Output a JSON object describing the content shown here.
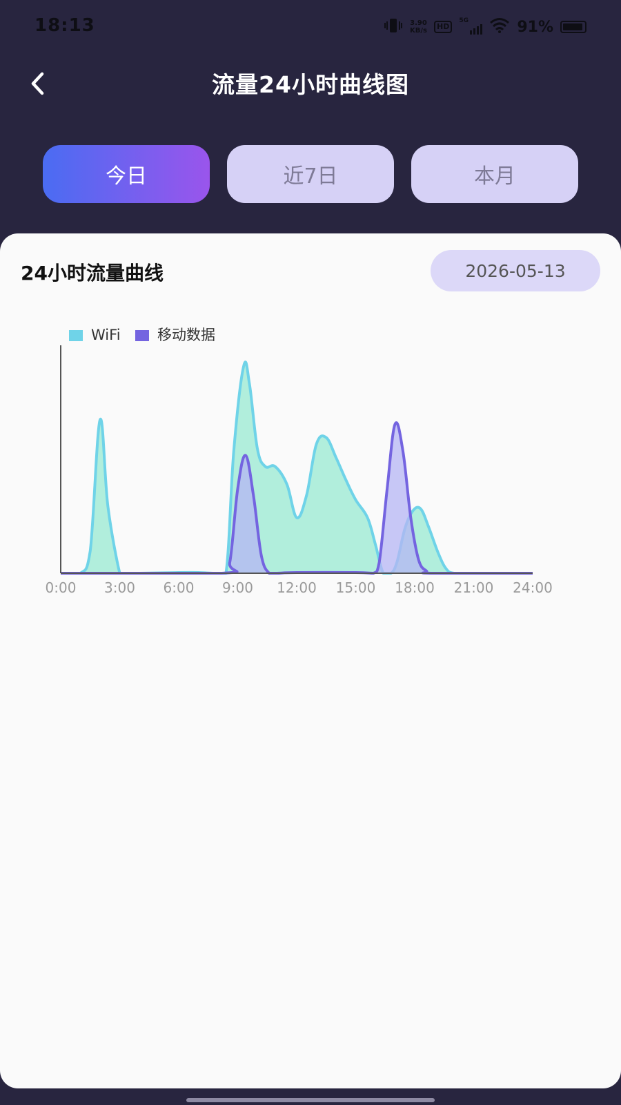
{
  "status_bar": {
    "time": "18:13",
    "net_speed_value": "3.90",
    "net_speed_unit": "KB/s",
    "hd_label": "HD",
    "network_label": "5G",
    "battery_percent": "91%",
    "battery_level": 0.91
  },
  "header": {
    "back_icon": "chevron-left-icon",
    "title": "流量24小时曲线图"
  },
  "tabs": [
    {
      "label": "今日",
      "active": true
    },
    {
      "label": "近7日",
      "active": false
    },
    {
      "label": "本月",
      "active": false
    }
  ],
  "card": {
    "title": "24小时流量曲线",
    "date": "2026-05-13"
  },
  "colors": {
    "background": "#28253f",
    "wifi_fill": "#a8ecd8",
    "wifi_line": "#6fd3e8",
    "mobile_fill": "#b6b6f4",
    "mobile_line": "#7464e0",
    "axis": "#555555",
    "tick_label": "#9a9a9a"
  },
  "chart_data": {
    "type": "area",
    "title": "",
    "xlabel": "",
    "ylabel": "",
    "x_ticks": [
      "0:00",
      "3:00",
      "6:00",
      "9:00",
      "12:00",
      "15:00",
      "18:00",
      "21:00",
      "24:00"
    ],
    "xlim": [
      0,
      24
    ],
    "ylim": [
      0,
      1
    ],
    "y_axis_labels_shown": false,
    "grid": false,
    "legend_position": "top-left",
    "series": [
      {
        "name": "WiFi",
        "x": [
          0,
          1,
          1.5,
          2,
          2.4,
          3,
          3.2,
          4,
          6,
          7,
          7.8,
          8.4,
          8.8,
          9.3,
          9.6,
          10,
          10.4,
          10.9,
          11.5,
          12,
          12.5,
          13,
          13.5,
          14,
          14.5,
          15,
          15.6,
          16,
          16.4,
          16.8,
          17.1,
          17.5,
          17.9,
          18.3,
          18.7,
          19.2,
          19.6,
          20,
          21,
          24
        ],
        "values": [
          0,
          0,
          0.1,
          0.69,
          0.3,
          0,
          0,
          0,
          0.003,
          0.003,
          0,
          0,
          0.55,
          0.93,
          0.85,
          0.56,
          0.48,
          0.48,
          0.4,
          0.25,
          0.35,
          0.58,
          0.61,
          0.52,
          0.42,
          0.33,
          0.25,
          0.13,
          0,
          0,
          0.05,
          0.2,
          0.28,
          0.29,
          0.21,
          0.09,
          0.02,
          0,
          0,
          0
        ]
      },
      {
        "name": "移动数据",
        "x": [
          0,
          8.2,
          8.6,
          9,
          9.4,
          9.8,
          10.2,
          10.6,
          11,
          12,
          15,
          15.9,
          16.2,
          16.6,
          17,
          17.4,
          17.8,
          18.2,
          18.6,
          18.9,
          24
        ],
        "values": [
          0,
          0,
          0.05,
          0.38,
          0.53,
          0.35,
          0.08,
          0,
          0,
          0.003,
          0.003,
          0,
          0.05,
          0.38,
          0.67,
          0.55,
          0.25,
          0.06,
          0.01,
          0,
          0
        ]
      }
    ]
  }
}
